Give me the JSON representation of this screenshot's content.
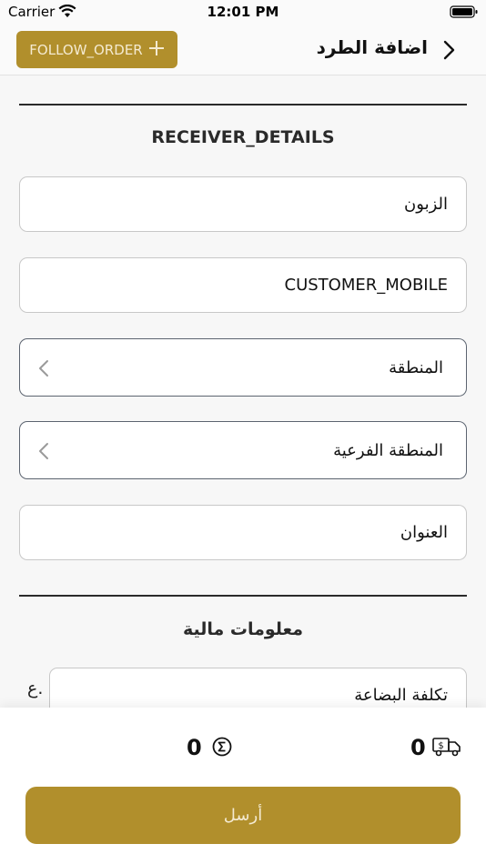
{
  "status_bar": {
    "carrier": "Carrier",
    "time": "12:01 PM"
  },
  "nav": {
    "title": "اضافة الطرد",
    "follow_order_label": "FOLLOW_ORDER"
  },
  "receiver_section": {
    "title": "RECEIVER_DETAILS",
    "customer_placeholder": "الزبون",
    "mobile_placeholder": "CUSTOMER_MOBILE",
    "region_label": "المنطقة",
    "subregion_label": "المنطقة الفرعية",
    "address_placeholder": "العنوان"
  },
  "financial_section": {
    "title": "معلومات مالية",
    "currency": "ع.",
    "goods_cost_placeholder": "تكلفة البضاعة"
  },
  "summary": {
    "total": "0",
    "delivery": "0",
    "send_label": "أرسل"
  },
  "colors": {
    "accent": "#b18f2c",
    "accent_text": "#f4ead1"
  },
  "icons": [
    "wifi-icon",
    "battery-icon",
    "back-icon",
    "plus-icon",
    "chevron-left-icon",
    "sigma-icon",
    "truck-icon"
  ]
}
